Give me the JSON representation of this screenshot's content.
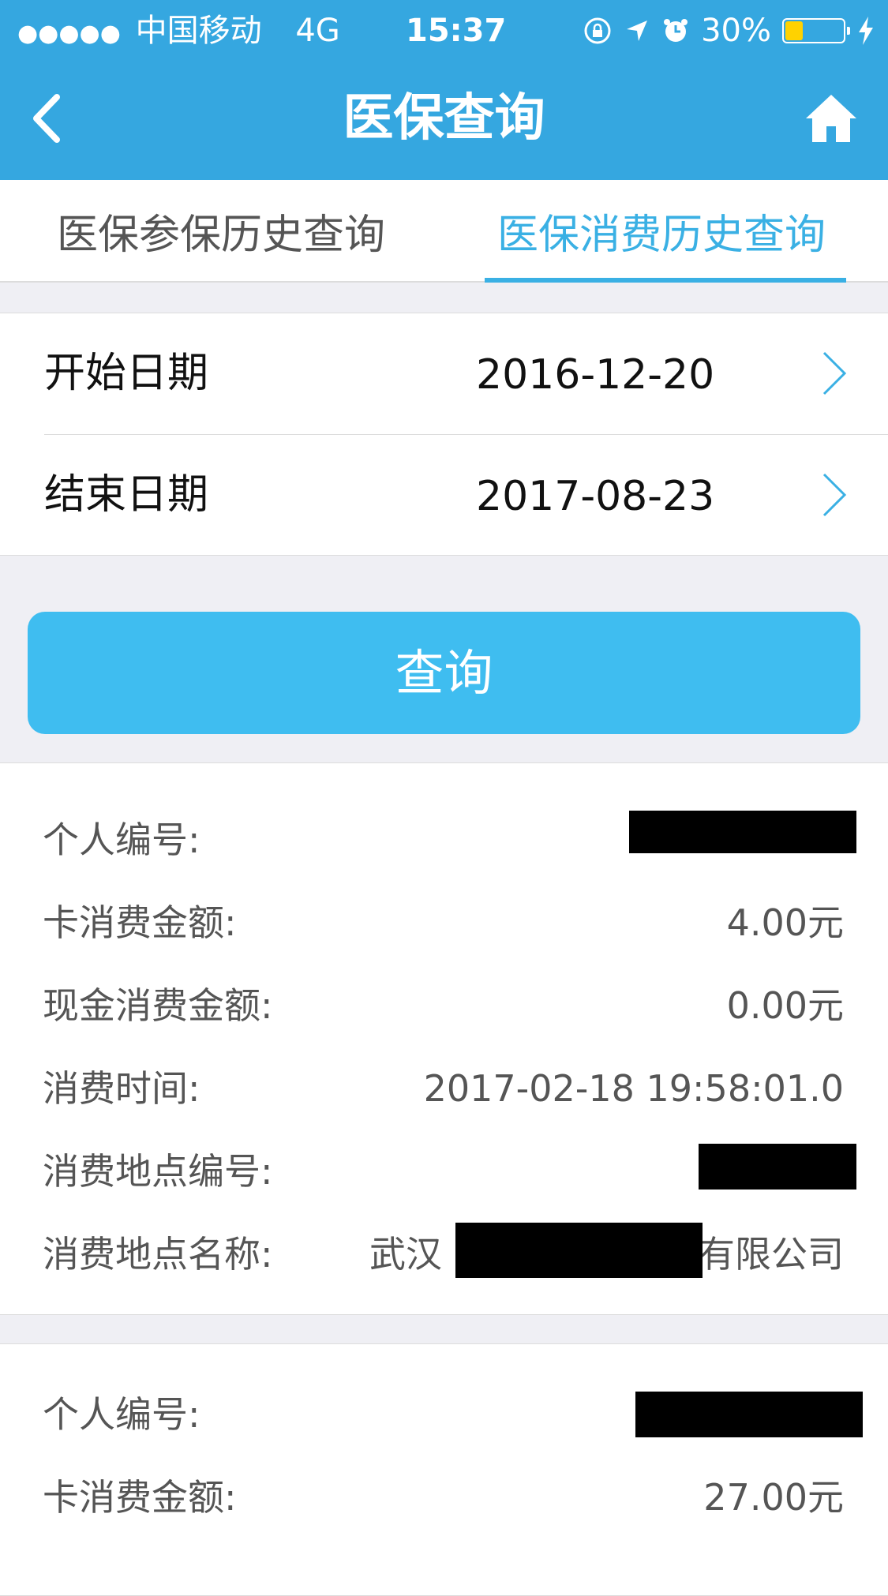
{
  "status_bar": {
    "carrier": "中国移动",
    "network": "4G",
    "time": "15:37",
    "battery_percent": "30%",
    "battery_level": 0.3
  },
  "navbar": {
    "title": "医保查询",
    "back_icon": "chevron-left-icon",
    "home_icon": "home-icon"
  },
  "tabs": [
    {
      "label": "医保参保历史查询",
      "active": false
    },
    {
      "label": "医保消费历史查询",
      "active": true
    }
  ],
  "date_filter": {
    "start_label": "开始日期",
    "start_value": "2016-12-20",
    "end_label": "结束日期",
    "end_value": "2017-08-23"
  },
  "query_button_label": "查询",
  "records": [
    {
      "personal_id_label": "个人编号:",
      "card_amount_label": "卡消费金额:",
      "card_amount": "4.00元",
      "cash_amount_label": "现金消费金额:",
      "cash_amount": "0.00元",
      "time_label": "消费时间:",
      "time": "2017-02-18 19:58:01.0",
      "place_id_label": "消费地点编号:",
      "place_name_label": "消费地点名称:",
      "place_name_prefix": "武汉",
      "place_name_suffix": "有限公司"
    },
    {
      "personal_id_label": "个人编号:",
      "card_amount_label": "卡消费金额:",
      "card_amount": "27.00元"
    }
  ],
  "colors": {
    "primary": "#35a7e0",
    "active_tab": "#3ab0e4",
    "button": "#3fbdf0",
    "background": "#efeff4"
  }
}
